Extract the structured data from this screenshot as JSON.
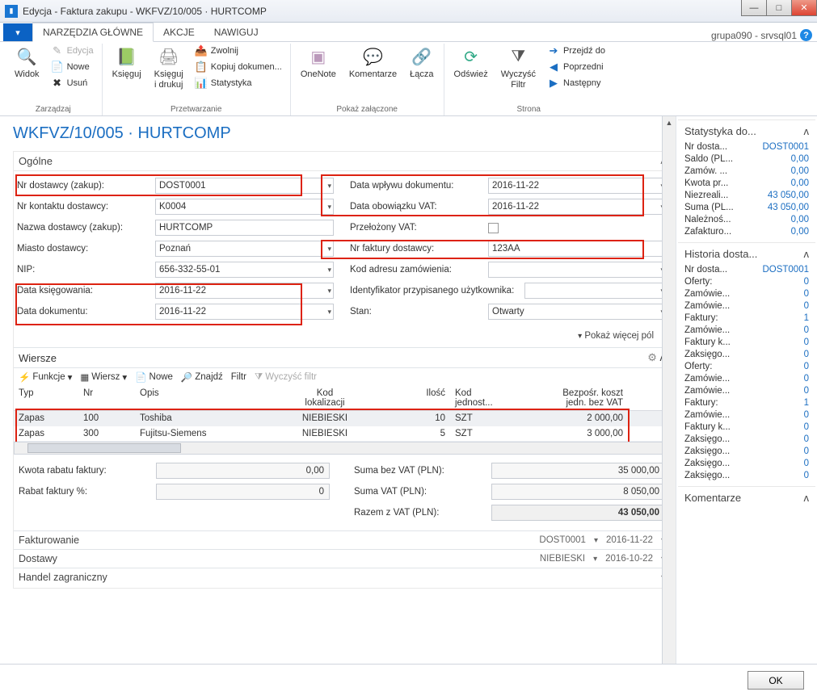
{
  "window": {
    "title": "Edycja - Faktura zakupu - WKFVZ/10/005 · HURTCOMP"
  },
  "user_label": "grupa090 - srvsql01",
  "tabs": {
    "home": "NARZĘDZIA GŁÓWNE",
    "akcje": "AKCJE",
    "nawiguj": "NAWIGUJ"
  },
  "ribbon": {
    "zarzadzaj": {
      "widok": "Widok",
      "edycja": "Edycja",
      "nowe": "Nowe",
      "usun": "Usuń",
      "label": "Zarządzaj"
    },
    "przetw": {
      "ksieguj": "Księguj",
      "ksieguj_drukuj": "Księguj\ni drukuj",
      "zwolnij": "Zwolnij",
      "kopiuj": "Kopiuj dokumen...",
      "statystyka": "Statystyka",
      "label": "Przetwarzanie"
    },
    "zalacz": {
      "onenote": "OneNote",
      "komentarze": "Komentarze",
      "lacza": "Łącza",
      "label": "Pokaż załączone"
    },
    "strona": {
      "odswiez": "Odśwież",
      "wyczysc": "Wyczyść\nFiltr",
      "przejdz": "Przejdź do",
      "poprzedni": "Poprzedni",
      "nastepny": "Następny",
      "label": "Strona"
    }
  },
  "page_title": "WKFVZ/10/005 · HURTCOMP",
  "fasttabs": {
    "ogolne": "Ogólne",
    "wiersze": "Wiersze",
    "fakturowanie": "Fakturowanie",
    "dostawy": "Dostawy",
    "handel": "Handel zagraniczny"
  },
  "ogolne": {
    "left": {
      "nr_dostawcy_lbl": "Nr dostawcy (zakup):",
      "nr_dostawcy": "DOST0001",
      "nr_kontaktu_lbl": "Nr kontaktu dostawcy:",
      "nr_kontaktu": "K0004",
      "nazwa_lbl": "Nazwa dostawcy (zakup):",
      "nazwa": "HURTCOMP",
      "miasto_lbl": "Miasto dostawcy:",
      "miasto": "Poznań",
      "nip_lbl": "NIP:",
      "nip": "656-332-55-01",
      "data_ksieg_lbl": "Data księgowania:",
      "data_ksieg": "2016-11-22",
      "data_dok_lbl": "Data dokumentu:",
      "data_dok": "2016-11-22"
    },
    "right": {
      "data_wplywu_lbl": "Data wpływu dokumentu:",
      "data_wplywu": "2016-11-22",
      "data_vat_lbl": "Data obowiązku VAT:",
      "data_vat": "2016-11-22",
      "przelozony_lbl": "Przełożony VAT:",
      "nr_fakt_lbl": "Nr faktury dostawcy:",
      "nr_fakt": "123AA",
      "kod_adr_lbl": "Kod adresu zamówienia:",
      "kod_adr": "",
      "ident_lbl": "Identyfikator przypisanego użytkownika:",
      "ident": "",
      "stan_lbl": "Stan:",
      "stan": "Otwarty"
    },
    "showmore": "Pokaż więcej pól"
  },
  "lines": {
    "toolbar": {
      "funkcje": "Funkcje",
      "wiersz": "Wiersz",
      "nowe": "Nowe",
      "znajdz": "Znajdź",
      "filtr": "Filtr",
      "wyczysc": "Wyczyść filtr"
    },
    "cols": {
      "typ": "Typ",
      "nr": "Nr",
      "opis": "Opis",
      "lok": "Kod\nlokalizacji",
      "ilosc": "Ilość",
      "jedn": "Kod\njednost...",
      "koszt": "Bezpośr. koszt\njedn. bez VAT"
    },
    "rows": [
      {
        "typ": "Zapas",
        "nr": "100",
        "opis": "Toshiba",
        "lok": "NIEBIESKI",
        "ilosc": "10",
        "jedn": "SZT",
        "koszt": "2 000,00"
      },
      {
        "typ": "Zapas",
        "nr": "300",
        "opis": "Fujitsu-Siemens",
        "lok": "NIEBIESKI",
        "ilosc": "5",
        "jedn": "SZT",
        "koszt": "3 000,00"
      }
    ]
  },
  "totals": {
    "kwota_rabatu_lbl": "Kwota rabatu faktury:",
    "kwota_rabatu": "0,00",
    "rabat_pct_lbl": "Rabat faktury %:",
    "rabat_pct": "0",
    "suma_bez_lbl": "Suma bez VAT (PLN):",
    "suma_bez": "35 000,00",
    "suma_vat_lbl": "Suma VAT (PLN):",
    "suma_vat": "8 050,00",
    "razem_lbl": "Razem z VAT (PLN):",
    "razem": "43 050,00"
  },
  "collapsed": {
    "fakturowanie_v1": "DOST0001",
    "fakturowanie_v2": "2016-11-22",
    "dostawy_v1": "NIEBIESKI",
    "dostawy_v2": "2016-10-22"
  },
  "side": {
    "stat_hdr": "Statystyka do...",
    "stat": [
      {
        "l": "Nr dosta...",
        "v": "DOST0001"
      },
      {
        "l": "Saldo (PL...",
        "v": "0,00"
      },
      {
        "l": "Zamów. ...",
        "v": "0,00"
      },
      {
        "l": "Kwota pr...",
        "v": "0,00"
      },
      {
        "l": "Niezreali...",
        "v": "43 050,00"
      },
      {
        "l": "Suma (PL...",
        "v": "43 050,00"
      },
      {
        "l": "Należnoś...",
        "v": "0,00"
      },
      {
        "l": "Zafakturo...",
        "v": "0,00"
      }
    ],
    "hist_hdr": "Historia dosta...",
    "hist": [
      {
        "l": "Nr dosta...",
        "v": "DOST0001"
      },
      {
        "l": "Oferty:",
        "v": "0"
      },
      {
        "l": "Zamówie...",
        "v": "0"
      },
      {
        "l": "Zamówie...",
        "v": "0"
      },
      {
        "l": "Faktury:",
        "v": "1"
      },
      {
        "l": "Zamówie...",
        "v": "0"
      },
      {
        "l": "Faktury k...",
        "v": "0"
      },
      {
        "l": "Zaksięgo...",
        "v": "0"
      },
      {
        "l": "Oferty:",
        "v": "0"
      },
      {
        "l": "Zamówie...",
        "v": "0"
      },
      {
        "l": "Zamówie...",
        "v": "0"
      },
      {
        "l": "Faktury:",
        "v": "1"
      },
      {
        "l": "Zamówie...",
        "v": "0"
      },
      {
        "l": "Faktury k...",
        "v": "0"
      },
      {
        "l": "Zaksięgo...",
        "v": "0"
      },
      {
        "l": "Zaksięgo...",
        "v": "0"
      },
      {
        "l": "Zaksięgo...",
        "v": "0"
      },
      {
        "l": "Zaksięgo...",
        "v": "0"
      }
    ],
    "kom_hdr": "Komentarze"
  },
  "footer": {
    "ok": "OK"
  }
}
